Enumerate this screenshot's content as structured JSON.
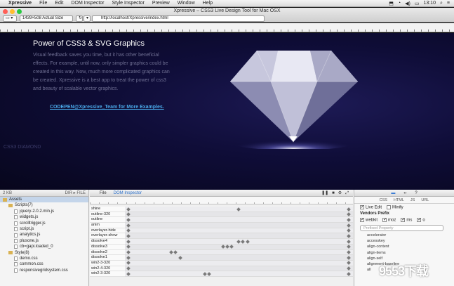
{
  "menubar": {
    "app_name": "Xpressive",
    "items": [
      "File",
      "Edit",
      "DOM Inspector",
      "Style Inspector",
      "Preview",
      "Window",
      "Help"
    ],
    "clock": "13:10"
  },
  "window": {
    "title": "Xpressive – CSS3 Live Design Tool for Mac OSX",
    "size_selector": "1439×508 Actual Size",
    "url": "http://localhost/Xpressive/index.html"
  },
  "canvas": {
    "heading": "Power of CSS3 & SVG Graphics",
    "body": "Visual feedback saves you time, but it has other beneficial effects. For example, until now, only simpler graphics could be created in this way. Now, much more complicated graphics can be created. Xpressive is a best app to treat the power of css3 and beauty of scalable vector graphics.",
    "link": "CODEPEN@Xpressive_Team for More Examples.",
    "corner_text": "CSS3 DIAMOND"
  },
  "left_panel": {
    "header_left": "2 KB",
    "header_right": "DIR ▸ FILE",
    "tree": [
      {
        "label": "Assets",
        "kind": "folder",
        "level": 0,
        "selected": true
      },
      {
        "label": "Scripts(7)",
        "kind": "folder",
        "level": 1
      },
      {
        "label": "jquery-2.0.2.min.js",
        "kind": "file",
        "level": 2
      },
      {
        "label": "widgets.js",
        "kind": "file",
        "level": 2
      },
      {
        "label": "scrolltrigger.js",
        "kind": "file",
        "level": 2
      },
      {
        "label": "script.js",
        "kind": "file",
        "level": 2
      },
      {
        "label": "analytics.js",
        "kind": "file",
        "level": 2
      },
      {
        "label": "plusone.js",
        "kind": "file",
        "level": 2
      },
      {
        "label": "cb=gapi.loaded_0",
        "kind": "file",
        "level": 2
      },
      {
        "label": "Style(8)",
        "kind": "folder",
        "level": 1
      },
      {
        "label": "demo.css",
        "kind": "file",
        "level": 2
      },
      {
        "label": "common.css",
        "kind": "file",
        "level": 2
      },
      {
        "label": "responsivegridsystem.css",
        "kind": "file",
        "level": 2
      }
    ]
  },
  "timeline": {
    "tabs": [
      "File",
      "DOM Inspector"
    ],
    "animations": [
      {
        "name": "shine",
        "keys": [
          0.01,
          0.5,
          0.99
        ]
      },
      {
        "name": "outline-320",
        "keys": [
          0.01,
          0.99
        ]
      },
      {
        "name": "outline",
        "keys": [
          0.01,
          0.99
        ]
      },
      {
        "name": "anim",
        "keys": [
          0.01,
          0.99
        ]
      },
      {
        "name": "overlayer-hide",
        "keys": [
          0.01,
          0.99
        ]
      },
      {
        "name": "overlayer-show",
        "keys": [
          0.01,
          0.99
        ]
      },
      {
        "name": "dissolve4",
        "keys": [
          0.01,
          0.5,
          0.52,
          0.54,
          0.99
        ]
      },
      {
        "name": "dissolve3",
        "keys": [
          0.01,
          0.43,
          0.45,
          0.47,
          0.99
        ]
      },
      {
        "name": "dissolve2",
        "keys": [
          0.01,
          0.2,
          0.22,
          0.99
        ]
      },
      {
        "name": "dissolve1",
        "keys": [
          0.01,
          0.24,
          0.99
        ]
      },
      {
        "name": "win2-3-320",
        "keys": [
          0.01,
          0.99
        ]
      },
      {
        "name": "win2-4-320",
        "keys": [
          0.01,
          0.99
        ]
      },
      {
        "name": "win2-3-320",
        "keys": [
          0.01,
          0.35,
          0.37,
          0.99
        ]
      }
    ]
  },
  "right_panel": {
    "tabs": [
      "CSS",
      "HTML",
      "JS",
      "URL"
    ],
    "live_edit": "Live Edit",
    "minify": "Minify",
    "vendors_heading": "Vendors Prefix",
    "vendors": [
      {
        "label": "webkit",
        "checked": true
      },
      {
        "label": "moz",
        "checked": true
      },
      {
        "label": "ms",
        "checked": true
      },
      {
        "label": "o",
        "checked": true
      }
    ],
    "search_placeholder": "Prefixed Property",
    "properties": [
      "accelerator",
      "accesskey",
      "align-content",
      "align-items",
      "align-self",
      "alignment-baseline",
      "all"
    ]
  },
  "watermark": "9553下载"
}
